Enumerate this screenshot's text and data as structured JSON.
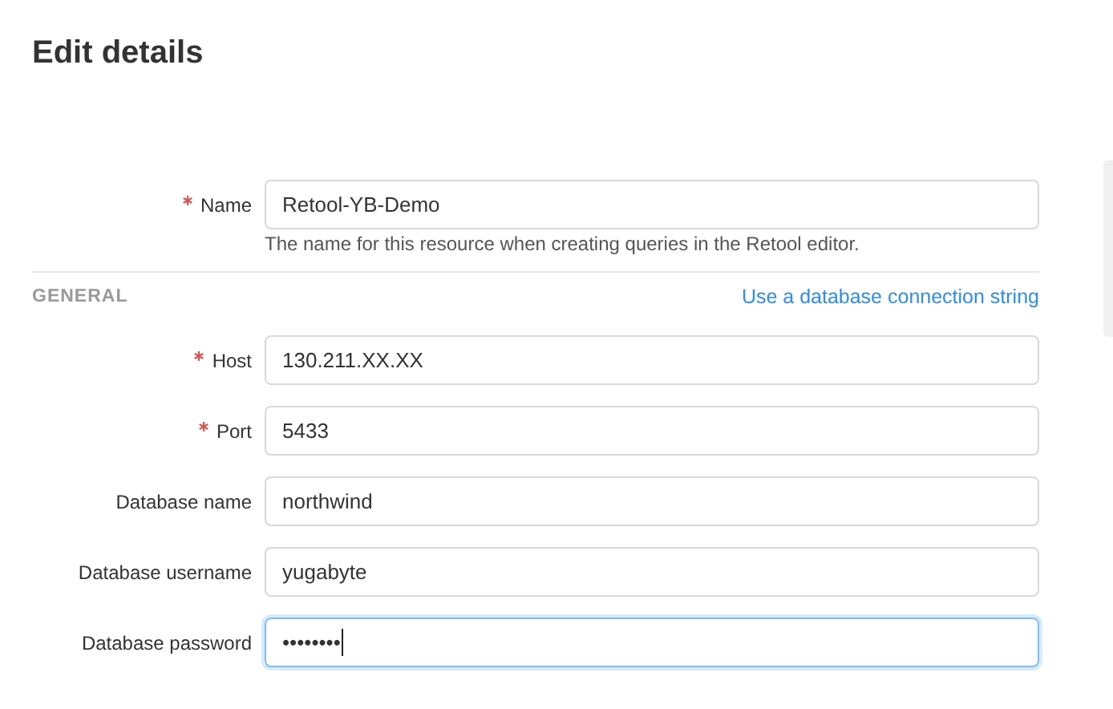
{
  "title": "Edit details",
  "name_field": {
    "label": "Name",
    "required": true,
    "value": "Retool-YB-Demo",
    "focused": false,
    "hint": "The name for this resource when creating queries in the Retool editor."
  },
  "section": {
    "heading": "GENERAL",
    "link": "Use a database connection string"
  },
  "fields": [
    {
      "label": "Host",
      "required": true,
      "value": "130.211.XX.XX",
      "focused": false
    },
    {
      "label": "Port",
      "required": true,
      "value": "5433",
      "focused": false
    },
    {
      "label": "Database name",
      "required": false,
      "value": "northwind",
      "focused": false
    },
    {
      "label": "Database username",
      "required": false,
      "value": "yugabyte",
      "focused": false
    },
    {
      "label": "Database password",
      "required": false,
      "value": "••••••••",
      "focused": true
    }
  ]
}
